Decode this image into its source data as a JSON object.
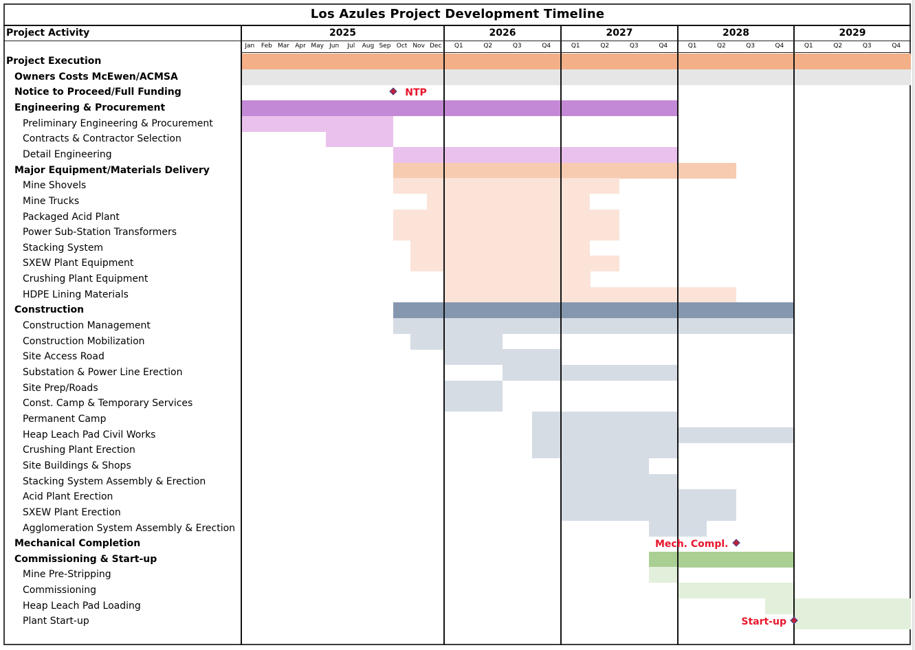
{
  "chart_data": {
    "type": "gantt",
    "title": "Los Azules Project Development Timeline",
    "column_header": "Project Activity",
    "time_unit": "months from Jan 2025",
    "years": [
      {
        "label": "2025",
        "start": 0,
        "end": 12,
        "periods": [
          "Jan",
          "Feb",
          "Mar",
          "Apr",
          "May",
          "Jun",
          "Jul",
          "Aug",
          "Sep",
          "Oct",
          "Nov",
          "Dec"
        ]
      },
      {
        "label": "2026",
        "start": 12,
        "end": 24,
        "periods": [
          "Q1",
          "Q2",
          "Q3",
          "Q4"
        ]
      },
      {
        "label": "2027",
        "start": 24,
        "end": 36,
        "periods": [
          "Q1",
          "Q2",
          "Q3",
          "Q4"
        ]
      },
      {
        "label": "2028",
        "start": 36,
        "end": 48,
        "periods": [
          "Q1",
          "Q2",
          "Q3",
          "Q4"
        ]
      },
      {
        "label": "2029",
        "start": 48,
        "end": 60,
        "periods": [
          "Q1",
          "Q2",
          "Q3",
          "Q4"
        ]
      }
    ],
    "colors": {
      "execution": "#F3AF88",
      "owners": "#E6E6E6",
      "engineering": "#C489D6",
      "engineering_sub": "#EAC1EC",
      "equipment": "#F6CBB0",
      "equipment_sub": "#FBE3D8",
      "construction": "#8597AF",
      "construction_sub": "#D5DCE4",
      "commissioning": "#AACF92",
      "commissioning_sub": "#E2EFDA",
      "milestone_text": "#E8162C"
    },
    "rows": [
      {
        "label": "Project Execution",
        "level": 0,
        "start": 0,
        "end": 60,
        "color": "execution"
      },
      {
        "label": "Owners Costs McEwen/ACMSA",
        "level": 1,
        "start": 0,
        "end": 60,
        "color": "owners"
      },
      {
        "label": "Notice to Proceed/Full Funding",
        "level": 1,
        "milestone": 9,
        "milestone_label": "NTP",
        "label_side": "right"
      },
      {
        "label": "Engineering & Procurement",
        "level": 1,
        "start": 0,
        "end": 36,
        "color": "engineering"
      },
      {
        "label": "Preliminary Engineering & Procurement",
        "level": 2,
        "start": 0,
        "end": 9,
        "color": "engineering_sub"
      },
      {
        "label": "Contracts & Contractor Selection",
        "level": 2,
        "start": 5,
        "end": 9,
        "color": "engineering_sub"
      },
      {
        "label": "Detail Engineering",
        "level": 2,
        "start": 9,
        "end": 36,
        "color": "engineering_sub"
      },
      {
        "label": "Major Equipment/Materials Delivery",
        "level": 1,
        "start": 9,
        "end": 42,
        "color": "equipment"
      },
      {
        "label": "Mine Shovels",
        "level": 2,
        "start": 9,
        "end": 30,
        "color": "equipment_sub"
      },
      {
        "label": "Mine Trucks",
        "level": 2,
        "start": 11,
        "end": 27,
        "color": "equipment_sub"
      },
      {
        "label": "Packaged Acid Plant",
        "level": 2,
        "start": 9,
        "end": 30,
        "color": "equipment_sub"
      },
      {
        "label": "Power Sub-Station Transformers",
        "level": 2,
        "start": 9,
        "end": 30,
        "color": "equipment_sub"
      },
      {
        "label": "Stacking System",
        "level": 2,
        "start": 10,
        "end": 27,
        "color": "equipment_sub"
      },
      {
        "label": "SXEW Plant Equipment",
        "level": 2,
        "start": 10,
        "end": 30,
        "color": "equipment_sub"
      },
      {
        "label": "Crushing Plant Equipment",
        "level": 2,
        "start": 12,
        "end": 27,
        "color": "equipment_sub"
      },
      {
        "label": "HDPE Lining Materials",
        "level": 2,
        "start": 12,
        "end": 42,
        "color": "equipment_sub"
      },
      {
        "label": "Construction",
        "level": 1,
        "start": 9,
        "end": 48,
        "color": "construction"
      },
      {
        "label": "Construction Management",
        "level": 2,
        "start": 9,
        "end": 48,
        "color": "construction_sub"
      },
      {
        "label": "Construction Mobilization",
        "level": 2,
        "start": 10,
        "end": 18,
        "color": "construction_sub"
      },
      {
        "label": "Site Access Road",
        "level": 2,
        "start": 12,
        "end": 24,
        "color": "construction_sub"
      },
      {
        "label": "Substation & Power Line Erection",
        "level": 2,
        "start": 18,
        "end": 36,
        "color": "construction_sub"
      },
      {
        "label": "Site Prep/Roads",
        "level": 2,
        "start": 12,
        "end": 18,
        "color": "construction_sub"
      },
      {
        "label": "Const. Camp & Temporary Services",
        "level": 2,
        "start": 12,
        "end": 18,
        "color": "construction_sub"
      },
      {
        "label": "Permanent Camp",
        "level": 2,
        "start": 21,
        "end": 36,
        "color": "construction_sub"
      },
      {
        "label": "Heap Leach Pad Civil Works",
        "level": 2,
        "start": 21,
        "end": 48,
        "color": "construction_sub"
      },
      {
        "label": "Crushing Plant Erection",
        "level": 2,
        "start": 21,
        "end": 36,
        "color": "construction_sub"
      },
      {
        "label": "Site Buildings & Shops",
        "level": 2,
        "start": 24,
        "end": 33,
        "color": "construction_sub"
      },
      {
        "label": "Stacking System Assembly & Erection",
        "level": 2,
        "start": 24,
        "end": 36,
        "color": "construction_sub"
      },
      {
        "label": "Acid Plant Erection",
        "level": 2,
        "start": 24,
        "end": 42,
        "color": "construction_sub"
      },
      {
        "label": "SXEW Plant Erection",
        "level": 2,
        "start": 24,
        "end": 42,
        "color": "construction_sub"
      },
      {
        "label": "Agglomeration System Assembly & Erection",
        "level": 2,
        "start": 33,
        "end": 39,
        "color": "construction_sub"
      },
      {
        "label": "Mechanical Completion",
        "level": 1,
        "milestone": 42,
        "milestone_label": "Mech. Compl.",
        "label_side": "left"
      },
      {
        "label": "Commissioning & Start-up",
        "level": 1,
        "start": 33,
        "end": 48,
        "color": "commissioning"
      },
      {
        "label": "Mine Pre-Stripping",
        "level": 2,
        "start": 33,
        "end": 36,
        "color": "commissioning_sub"
      },
      {
        "label": "Commissioning",
        "level": 2,
        "start": 36,
        "end": 48,
        "color": "commissioning_sub"
      },
      {
        "label": "Heap Leach Pad Loading",
        "level": 2,
        "start": 45,
        "end": 60,
        "color": "commissioning_sub"
      },
      {
        "label": "Plant Start-up",
        "level": 2,
        "start": 48,
        "end": 60,
        "color": "commissioning_sub",
        "milestone": 48,
        "milestone_label": "Start-up",
        "label_side": "left"
      }
    ]
  }
}
